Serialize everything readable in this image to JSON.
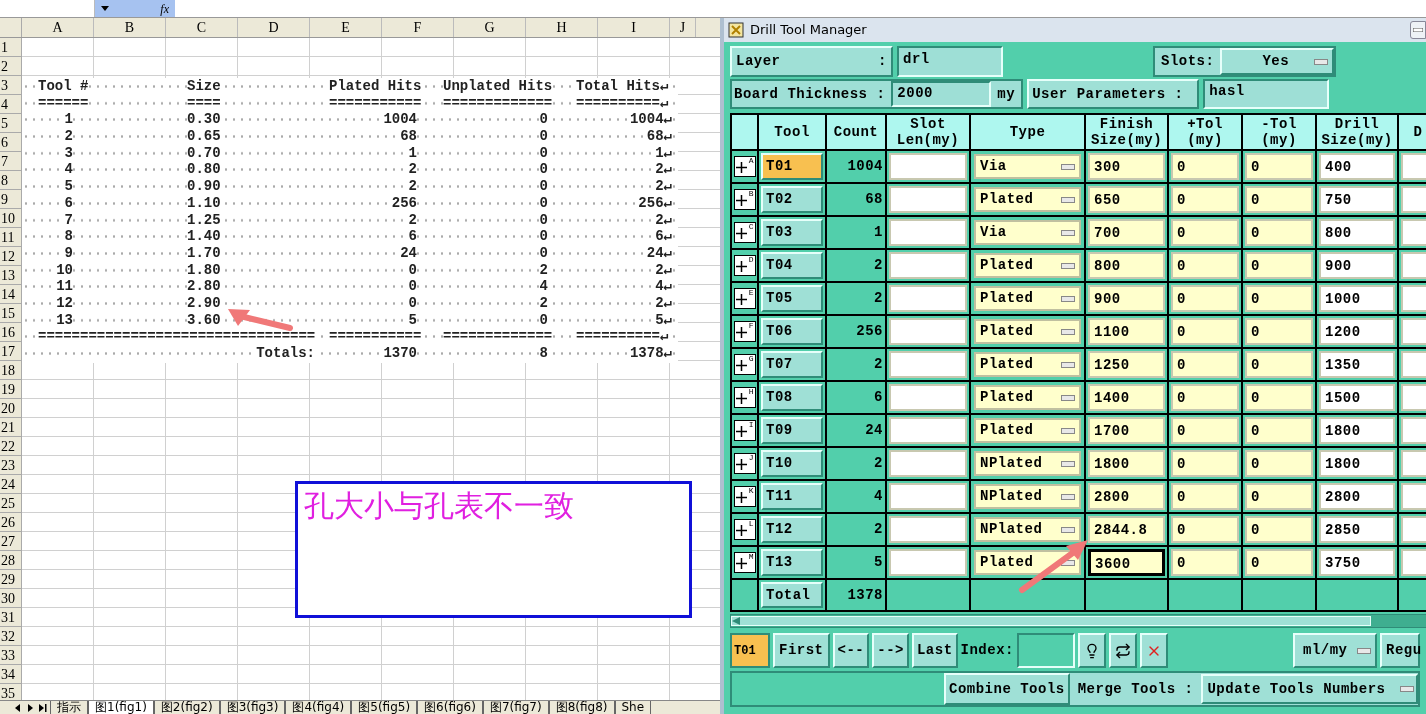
{
  "formula_bar": {
    "function_label": "fx"
  },
  "sheet": {
    "columns": [
      "A",
      "B",
      "C",
      "D",
      "E",
      "F",
      "G",
      "H",
      "I",
      "J"
    ],
    "row_headers": [
      "1",
      "2",
      "3",
      "4",
      "5",
      "6",
      "7",
      "8",
      "9",
      "10",
      "11",
      "12",
      "13",
      "14",
      "15",
      "16",
      "17",
      "18",
      "19",
      "20",
      "21",
      "22",
      "23",
      "24",
      "25",
      "26",
      "27",
      "28",
      "29",
      "30",
      "31",
      "32",
      "33",
      "34",
      "35"
    ],
    "report": {
      "header": {
        "tool": "Tool #",
        "size": "Size",
        "plated": "Plated Hits",
        "unplated": "Unplated Hits",
        "total": "Total Hits↵"
      },
      "rule_top": {
        "tool": "======",
        "size": "====",
        "plated": "===========",
        "unplated": "=============",
        "total": "==========↵"
      },
      "rows": [
        {
          "tool": "1",
          "size": "0.30",
          "plated": "1004",
          "unplated": "0",
          "total": "1004↵"
        },
        {
          "tool": "2",
          "size": "0.65",
          "plated": "68",
          "unplated": "0",
          "total": "68↵"
        },
        {
          "tool": "3",
          "size": "0.70",
          "plated": "1",
          "unplated": "0",
          "total": "1↵"
        },
        {
          "tool": "4",
          "size": "0.80",
          "plated": "2",
          "unplated": "0",
          "total": "2↵"
        },
        {
          "tool": "5",
          "size": "0.90",
          "plated": "2",
          "unplated": "0",
          "total": "2↵"
        },
        {
          "tool": "6",
          "size": "1.10",
          "plated": "256",
          "unplated": "0",
          "total": "256↵"
        },
        {
          "tool": "7",
          "size": "1.25",
          "plated": "2",
          "unplated": "0",
          "total": "2↵"
        },
        {
          "tool": "8",
          "size": "1.40",
          "plated": "6",
          "unplated": "0",
          "total": "6↵"
        },
        {
          "tool": "9",
          "size": "1.70",
          "plated": "24",
          "unplated": "0",
          "total": "24↵"
        },
        {
          "tool": "10",
          "size": "1.80",
          "plated": "0",
          "unplated": "2",
          "total": "2↵"
        },
        {
          "tool": "11",
          "size": "2.80",
          "plated": "0",
          "unplated": "4",
          "total": "4↵"
        },
        {
          "tool": "12",
          "size": "2.90",
          "plated": "0",
          "unplated": "2",
          "total": "2↵"
        },
        {
          "tool": "13",
          "size": "3.60",
          "plated": "5",
          "unplated": "0",
          "total": "5↵"
        }
      ],
      "rule_bottom": {
        "wide": "=================================",
        "plated": "===========",
        "unplated": "=============",
        "total": "==========↵"
      },
      "totals": {
        "label": "Totals:",
        "plated": "1370",
        "unplated": "8",
        "total": "1378↵"
      }
    },
    "note": "孔大小与孔表不一致",
    "tabs": [
      {
        "label": "指示",
        "selected": false
      },
      {
        "label": "图1(fig1)",
        "selected": true
      },
      {
        "label": "图2(fig2)",
        "selected": false
      },
      {
        "label": "图3(fig3)",
        "selected": false
      },
      {
        "label": "图4(fig4)",
        "selected": false
      },
      {
        "label": "图5(fig5)",
        "selected": false
      },
      {
        "label": "图6(fig6)",
        "selected": false
      },
      {
        "label": "图7(fig7)",
        "selected": false
      },
      {
        "label": "图8(fig8)",
        "selected": false
      },
      {
        "label": "She",
        "selected": false
      }
    ]
  },
  "window": {
    "title": "Drill Tool Manager",
    "layer": {
      "label": "Layer",
      "colon": ":",
      "value": "drl"
    },
    "slots": {
      "label": "Slots:",
      "value": "Yes"
    },
    "board_thickness": {
      "label": "Board Thickness :",
      "value": "2000",
      "unit": "my"
    },
    "user_parameters": {
      "label": "User Parameters :",
      "value": "hasl"
    },
    "columns": [
      [
        "Tool"
      ],
      [
        "Count"
      ],
      [
        "Slot",
        "Len(my)"
      ],
      [
        "Type"
      ],
      [
        "Finish",
        "Size(my)"
      ],
      [
        "+Tol",
        "(my)"
      ],
      [
        "-Tol",
        "(my)"
      ],
      [
        "Drill",
        "Size(my)"
      ],
      [
        "D"
      ]
    ],
    "rows": [
      {
        "marker": "A",
        "tool": "T01",
        "count": "1004",
        "type": "Via",
        "finish": "300",
        "plus_tol": "0",
        "minus_tol": "0",
        "drill": "400",
        "selected": true,
        "focused": false
      },
      {
        "marker": "B",
        "tool": "T02",
        "count": "68",
        "type": "Plated",
        "finish": "650",
        "plus_tol": "0",
        "minus_tol": "0",
        "drill": "750",
        "selected": false,
        "focused": false
      },
      {
        "marker": "C",
        "tool": "T03",
        "count": "1",
        "type": "Via",
        "finish": "700",
        "plus_tol": "0",
        "minus_tol": "0",
        "drill": "800",
        "selected": false,
        "focused": false
      },
      {
        "marker": "D",
        "tool": "T04",
        "count": "2",
        "type": "Plated",
        "finish": "800",
        "plus_tol": "0",
        "minus_tol": "0",
        "drill": "900",
        "selected": false,
        "focused": false
      },
      {
        "marker": "E",
        "tool": "T05",
        "count": "2",
        "type": "Plated",
        "finish": "900",
        "plus_tol": "0",
        "minus_tol": "0",
        "drill": "1000",
        "selected": false,
        "focused": false
      },
      {
        "marker": "F",
        "tool": "T06",
        "count": "256",
        "type": "Plated",
        "finish": "1100",
        "plus_tol": "0",
        "minus_tol": "0",
        "drill": "1200",
        "selected": false,
        "focused": false
      },
      {
        "marker": "G",
        "tool": "T07",
        "count": "2",
        "type": "Plated",
        "finish": "1250",
        "plus_tol": "0",
        "minus_tol": "0",
        "drill": "1350",
        "selected": false,
        "focused": false
      },
      {
        "marker": "H",
        "tool": "T08",
        "count": "6",
        "type": "Plated",
        "finish": "1400",
        "plus_tol": "0",
        "minus_tol": "0",
        "drill": "1500",
        "selected": false,
        "focused": false
      },
      {
        "marker": "I",
        "tool": "T09",
        "count": "24",
        "type": "Plated",
        "finish": "1700",
        "plus_tol": "0",
        "minus_tol": "0",
        "drill": "1800",
        "selected": false,
        "focused": false
      },
      {
        "marker": "J",
        "tool": "T10",
        "count": "2",
        "type": "NPlated",
        "finish": "1800",
        "plus_tol": "0",
        "minus_tol": "0",
        "drill": "1800",
        "selected": false,
        "focused": false
      },
      {
        "marker": "K",
        "tool": "T11",
        "count": "4",
        "type": "NPlated",
        "finish": "2800",
        "plus_tol": "0",
        "minus_tol": "0",
        "drill": "2800",
        "selected": false,
        "focused": false
      },
      {
        "marker": "L",
        "tool": "T12",
        "count": "2",
        "type": "NPlated",
        "finish": "2844.8",
        "plus_tol": "0",
        "minus_tol": "0",
        "drill": "2850",
        "selected": false,
        "focused": false
      },
      {
        "marker": "M",
        "tool": "T13",
        "count": "5",
        "type": "Plated",
        "finish": "3600",
        "plus_tol": "0",
        "minus_tol": "0",
        "drill": "3750",
        "selected": false,
        "focused": true
      }
    ],
    "total": {
      "label": "Total",
      "count": "1378"
    },
    "nav": {
      "current": "T01",
      "first": "First",
      "prev": "<--",
      "next": "-->",
      "last": "Last",
      "index_label": "Index:",
      "units": "ml/my",
      "cut_button": "Regu"
    },
    "bottom": {
      "combine": "Combine Tools",
      "merge_label": "Merge Tools :",
      "merge_value": "Update Tools Numbers"
    }
  }
}
